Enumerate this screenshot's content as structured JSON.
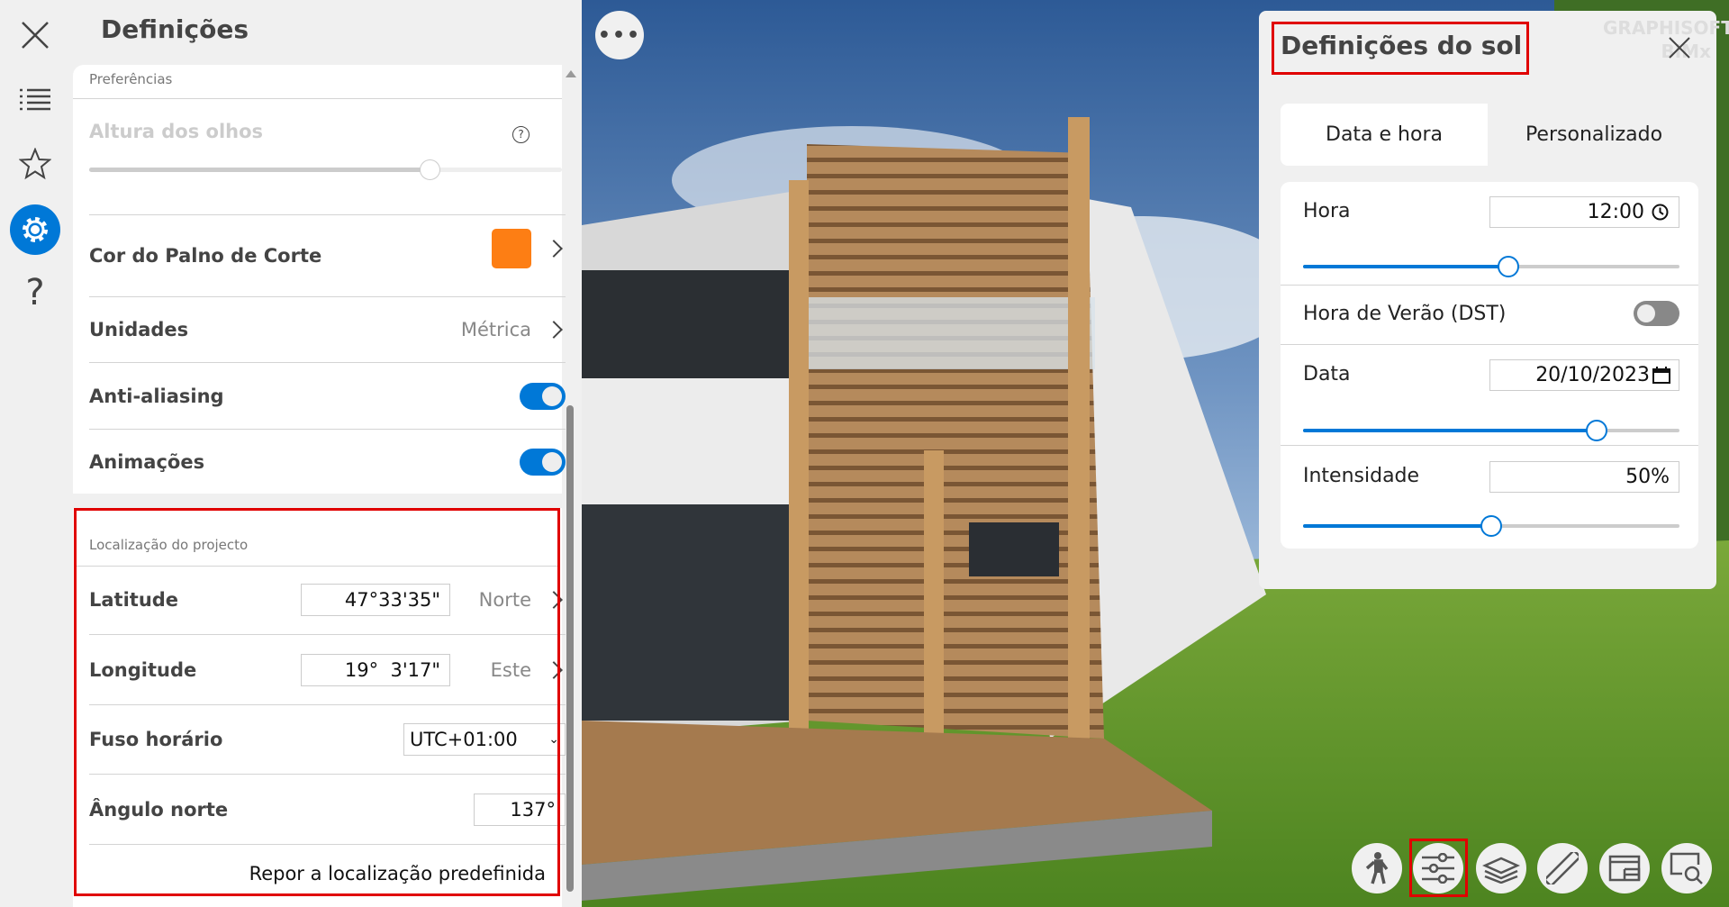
{
  "settings": {
    "title": "Definições",
    "sections": {
      "preferences": "Preferências",
      "location": "Localização do projecto"
    },
    "eye_height": {
      "label": "Altura dos olhos",
      "slider": 0.72
    },
    "cut_plane": {
      "label": "Cor do Palno de Corte",
      "color": "#fd7e14"
    },
    "units": {
      "label": "Unidades",
      "value": "Métrica"
    },
    "antialiasing": {
      "label": "Anti-aliasing",
      "on": true
    },
    "animations": {
      "label": "Animações",
      "on": true
    },
    "latitude": {
      "label": "Latitude",
      "value": "47°33'35\"",
      "dir": "Norte"
    },
    "longitude": {
      "label": "Longitude",
      "value": "19°  3'17\"",
      "dir": "Este"
    },
    "timezone": {
      "label": "Fuso horário",
      "value": "UTC+01:00"
    },
    "north": {
      "label": "Ângulo norte",
      "value": "137°"
    },
    "reset": "Repor a localização predefinida"
  },
  "sun": {
    "title": "Definições do sol",
    "watermark": "GRAPHISOFT BIMx",
    "tabs": [
      "Data e hora",
      "Personalizado"
    ],
    "hour": {
      "label": "Hora",
      "value": "12:00",
      "slider": 0.545
    },
    "dst": {
      "label": "Hora de Verão (DST)",
      "on": false
    },
    "date": {
      "label": "Data",
      "value": "20/10/2023",
      "slider": 0.78
    },
    "intensity": {
      "label": "Intensidade",
      "value": "50%",
      "slider": 0.5
    }
  },
  "colors": {
    "accent": "#0078d7",
    "highlight": "#e00000"
  }
}
